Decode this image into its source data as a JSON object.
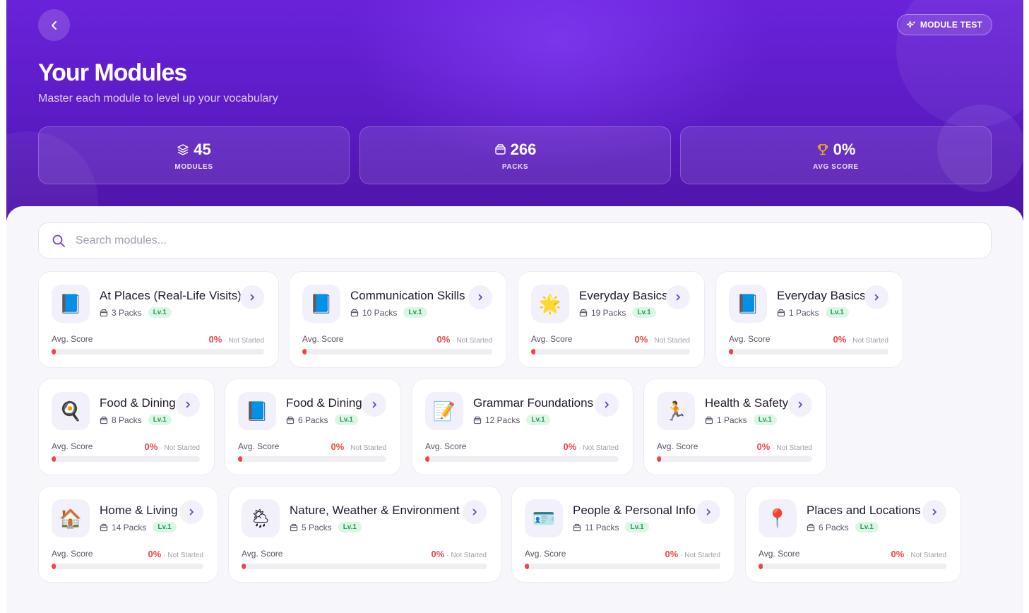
{
  "header": {
    "title": "Your Modules",
    "subtitle": "Master each module to level up your vocabulary",
    "module_test_label": "MODULE TEST"
  },
  "stats": [
    {
      "value": "45",
      "label": "MODULES",
      "icon": "layers-icon"
    },
    {
      "value": "266",
      "label": "PACKS",
      "icon": "package-icon"
    },
    {
      "value": "0%",
      "label": "AVG SCORE",
      "icon": "trophy-icon"
    }
  ],
  "search": {
    "placeholder": "Search modules..."
  },
  "card_labels": {
    "avg_score": "Avg. Score",
    "status": "· Not Started"
  },
  "modules": [
    {
      "name": "At Places (Real-Life Visits)",
      "packs": "3 Packs",
      "level": "Lv.1",
      "score": "0%",
      "progress": 0,
      "icon": "📘"
    },
    {
      "name": "Communication Skills",
      "packs": "10 Packs",
      "level": "Lv.1",
      "score": "0%",
      "progress": 0,
      "icon": "📘"
    },
    {
      "name": "Everyday Basics",
      "packs": "19 Packs",
      "level": "Lv.1",
      "score": "0%",
      "progress": 0,
      "icon": "🌟"
    },
    {
      "name": "Everyday Basics",
      "packs": "1 Packs",
      "level": "Lv.1",
      "score": "0%",
      "progress": 0,
      "icon": "📘"
    },
    {
      "name": "Food & Dining",
      "packs": "8 Packs",
      "level": "Lv.1",
      "score": "0%",
      "progress": 0,
      "icon": "🍳"
    },
    {
      "name": "Food & Dining",
      "packs": "6 Packs",
      "level": "Lv.1",
      "score": "0%",
      "progress": 0,
      "icon": "📘"
    },
    {
      "name": "Grammar Foundations",
      "packs": "12 Packs",
      "level": "Lv.1",
      "score": "0%",
      "progress": 0,
      "icon": "📝"
    },
    {
      "name": "Health & Safety",
      "packs": "1 Packs",
      "level": "Lv.1",
      "score": "0%",
      "progress": 0,
      "icon": "🏃"
    },
    {
      "name": "Home & Living",
      "packs": "14 Packs",
      "level": "Lv.1",
      "score": "0%",
      "progress": 0,
      "icon": "🏠"
    },
    {
      "name": "Nature, Weather & Environment",
      "packs": "5 Packs",
      "level": "Lv.1",
      "score": "0%",
      "progress": 0,
      "icon": "🌦"
    },
    {
      "name": "People & Personal Info",
      "packs": "11 Packs",
      "level": "Lv.1",
      "score": "0%",
      "progress": 0,
      "icon": "🪪"
    },
    {
      "name": "Places and Locations",
      "packs": "6 Packs",
      "level": "Lv.1",
      "score": "0%",
      "progress": 0,
      "icon": "📍"
    }
  ],
  "colors": {
    "accent": "#6a22d9",
    "score": "#ef4444",
    "level_bg": "#dcf6e6",
    "level_text": "#1f9d55"
  }
}
